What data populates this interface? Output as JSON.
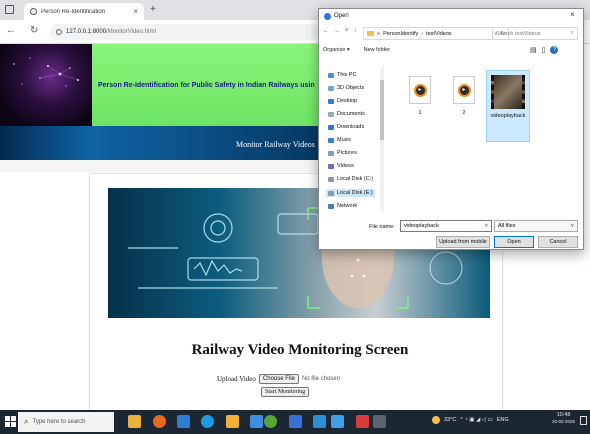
{
  "browser": {
    "tab_title": "Person Re-Identification",
    "tab_close": "×",
    "new_tab": "+",
    "url_host": "127.0.0.1:8000",
    "url_path": "/MonitorVideo.html"
  },
  "page": {
    "banner_title": "Person Re-Identification for Public Safety in Indian Railways usin",
    "nav_link": "Monitor Railway Videos",
    "heading": "Railway Video Monitoring Screen",
    "upload_label": "Upload Video",
    "choose_file": "Choose File",
    "no_file": "No file chosen",
    "start_button": "Start Monitoring"
  },
  "dialog": {
    "title": "Open",
    "close": "×",
    "breadcrumb": [
      "«",
      "PersonIdentify",
      "›",
      "testVideos"
    ],
    "search_placeholder": "Search testVideos",
    "organize": "Organize ▾",
    "new_folder": "New folder",
    "nav_items": [
      {
        "label": "This PC",
        "color": "#4a8fd8"
      },
      {
        "label": "3D Objects",
        "color": "#6fa8dc"
      },
      {
        "label": "Desktop",
        "color": "#2f7fd1"
      },
      {
        "label": "Documents",
        "color": "#9aa7b5"
      },
      {
        "label": "Downloads",
        "color": "#2a78d4"
      },
      {
        "label": "Music",
        "color": "#3a7fd6"
      },
      {
        "label": "Pictures",
        "color": "#6fa0d8"
      },
      {
        "label": "Videos",
        "color": "#6a6fb8"
      },
      {
        "label": "Local Disk (C:)",
        "color": "#8a9aa8"
      },
      {
        "label": "Local Disk (E:)",
        "color": "#8a9aa8"
      },
      {
        "label": "Network",
        "color": "#4a7fb8"
      }
    ],
    "files": [
      {
        "name": "1",
        "kind": "video"
      },
      {
        "name": "2",
        "kind": "video"
      },
      {
        "name": "videoplayback",
        "kind": "thumbnail",
        "selected": true
      }
    ],
    "file_name_label": "File name:",
    "file_name_value": "videoplayback",
    "file_type": "All files",
    "upload_from_mobile": "Upload from mobile",
    "open": "Open",
    "cancel": "Cancel"
  },
  "taskbar": {
    "search_placeholder": "Type here to search",
    "weather": "33°C",
    "language": "ENG",
    "time": "10:48",
    "date": "20-02-2025"
  },
  "colors": {
    "banner_green": "#6ee464",
    "banner_text": "#1a1f8a",
    "nav_blue": "#0e63a5",
    "taskbar": "#1c2733",
    "dialog_accent": "#0078d7"
  }
}
